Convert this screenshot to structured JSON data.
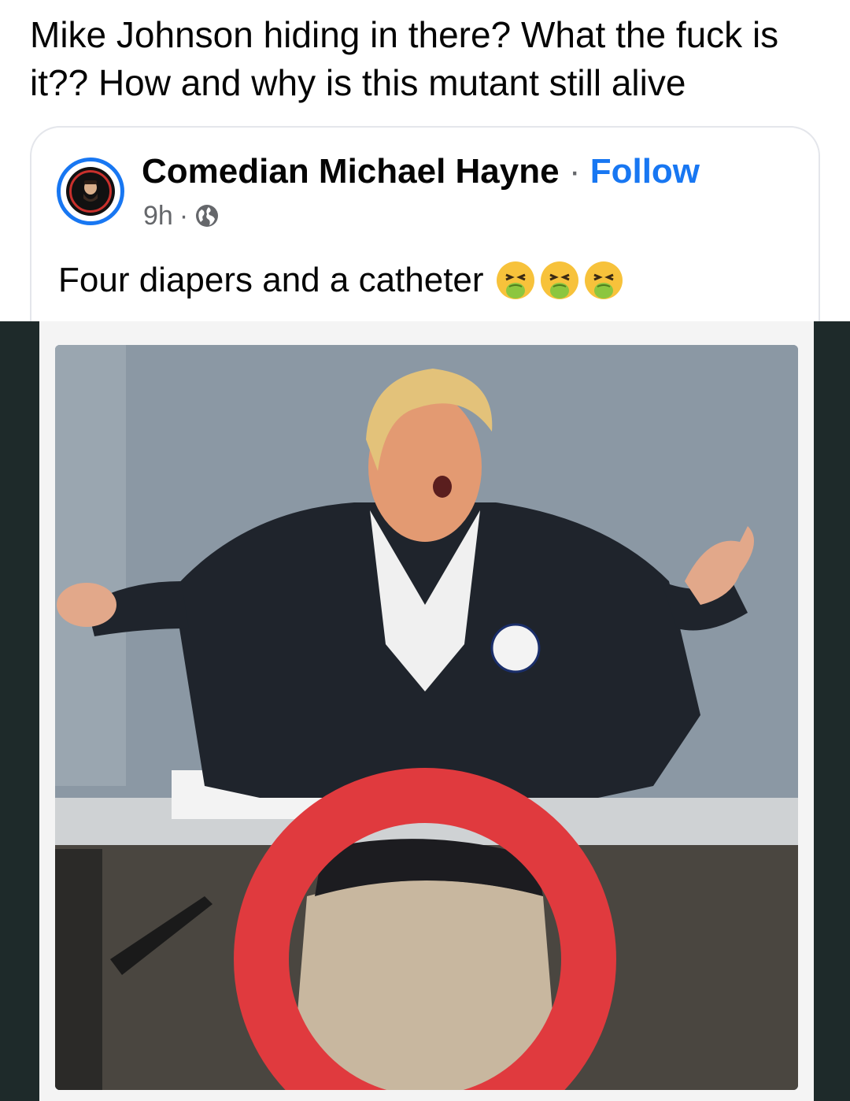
{
  "caption": "Mike Johnson hiding in there? What the fuck is it?? How and why is  this mutant still alive",
  "shared_post": {
    "author": "Comedian Michael Hayne",
    "separator": " · ",
    "follow_label": "Follow",
    "time": "9h",
    "meta_separator": "·",
    "privacy_icon": "globe-icon",
    "text": "Four diapers and a catheter",
    "emojis": [
      "nauseated-face",
      "nauseated-face",
      "nauseated-face"
    ],
    "avatar_ring_color": "#1877f2"
  },
  "photo": {
    "description_icon": "photo",
    "highlight_color": "#e03a3e"
  }
}
